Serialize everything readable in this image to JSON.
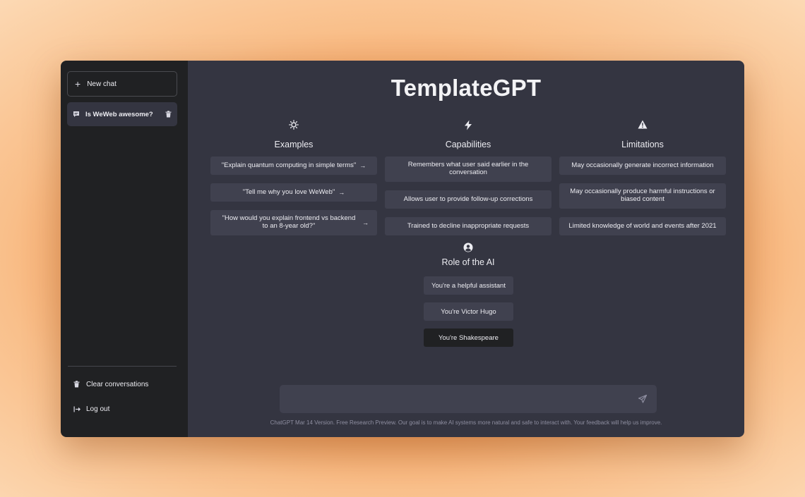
{
  "sidebar": {
    "new_chat": "New chat",
    "conversations": [
      {
        "title": "Is WeWeb awesome?"
      }
    ],
    "clear": "Clear conversations",
    "logout": "Log out"
  },
  "main": {
    "title": "TemplateGPT",
    "columns": [
      {
        "heading": "Examples",
        "icon": "sun-icon",
        "items": [
          "\"Explain quantum computing in simple terms\"",
          "\"Tell me why you love WeWeb\"",
          "\"How would you explain frontend vs backend to an 8-year old?\""
        ],
        "arrow": "→"
      },
      {
        "heading": "Capabilities",
        "icon": "lightning-icon",
        "items": [
          "Remembers what user said earlier in the conversation",
          "Allows user to provide follow-up corrections",
          "Trained to decline inappropriate requests"
        ]
      },
      {
        "heading": "Limitations",
        "icon": "warning-icon",
        "items": [
          "May occasionally generate incorrect information",
          "May occasionally produce harmful instructions or biased content",
          "Limited knowledge of world and events after 2021"
        ]
      }
    ],
    "role": {
      "heading": "Role of the AI",
      "icon": "user-circle-icon",
      "options": [
        "You're a helpful assistant",
        "You're Victor Hugo",
        "You're Shakespeare"
      ],
      "selected": "You're Shakespeare"
    },
    "input": {
      "placeholder": ""
    },
    "footer": "ChatGPT Mar 14 Version. Free Research Preview. Our goal is to make AI systems more natural and safe to interact with. Your feedback will help us improve."
  },
  "colors": {
    "sidebar_bg": "#202123",
    "main_bg": "#343541",
    "card_bg": "#40414f",
    "selected_role_bg": "#202123",
    "background_accent": "#f2893a"
  }
}
